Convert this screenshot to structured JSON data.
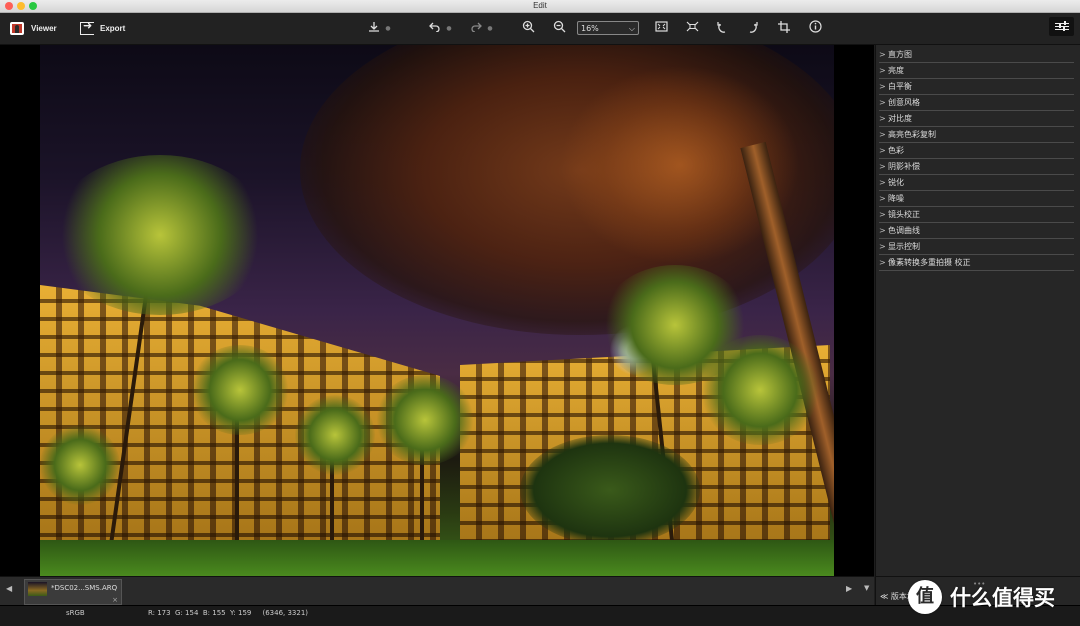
{
  "window": {
    "title": "Edit"
  },
  "toolbar": {
    "viewer_label": "Viewer",
    "export_label": "Export",
    "zoom_value": "16%"
  },
  "panel": {
    "items": [
      {
        "label": "直方图"
      },
      {
        "label": "亮度"
      },
      {
        "label": "白平衡"
      },
      {
        "label": "创意风格"
      },
      {
        "label": "对比度"
      },
      {
        "label": "高亮色彩复制"
      },
      {
        "label": "色彩"
      },
      {
        "label": "阴影补偿"
      },
      {
        "label": "锐化"
      },
      {
        "label": "降噪"
      },
      {
        "label": "镜头校正"
      },
      {
        "label": "色调曲线"
      },
      {
        "label": "显示控制"
      },
      {
        "label": "像素转换多重拍摄 校正"
      }
    ],
    "footer_label": "版本堆"
  },
  "filmstrip": {
    "file_name": "*DSC02...SMS.ARQ"
  },
  "status": {
    "color_space": "sRGB",
    "pixel_info": "R: 173  G: 154  B: 155  Y: 159     (6346, 3321)"
  },
  "watermark": {
    "text": "什么值得买"
  }
}
